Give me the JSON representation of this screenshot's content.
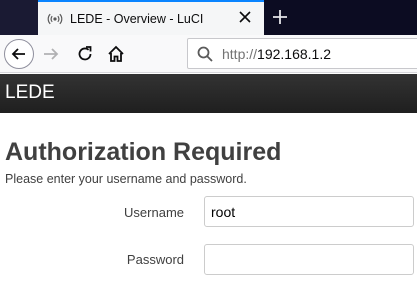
{
  "browser": {
    "tab": {
      "title": "LEDE - Overview - LuCI"
    },
    "url": {
      "prefix": "http://",
      "host": "192.168.1.2"
    }
  },
  "header": {
    "brand": "LEDE"
  },
  "login": {
    "title": "Authorization Required",
    "description": "Please enter your username and password.",
    "username_label": "Username",
    "username_value": "root",
    "password_label": "Password",
    "password_value": ""
  },
  "icons": [
    "broadcast-icon",
    "close-icon",
    "plus-icon",
    "back-arrow-icon",
    "forward-arrow-icon",
    "reload-icon",
    "home-icon",
    "search-icon"
  ],
  "colors": {
    "tab_accent": "#0a84ff",
    "header_bg": "#2b2b2b",
    "title_text": "#404040"
  }
}
